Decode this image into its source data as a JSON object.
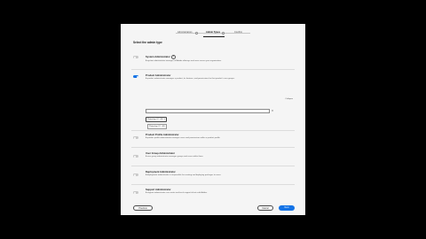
{
  "stepper": {
    "steps": [
      {
        "label": "Administrators"
      },
      {
        "label": "Admin Types"
      },
      {
        "label": "Confirm"
      }
    ],
    "active_index": 1
  },
  "section_title": "Select the admin type",
  "roles": [
    {
      "name": "System Administrator",
      "description": "A system administrator manages all Adobe offerings and users across your organization.",
      "enabled": false,
      "has_info": true
    },
    {
      "name": "Product Administrator",
      "description": "A product administrator manages a product, its features, and permissions for that product's user groups.",
      "enabled": true,
      "has_info": false
    },
    {
      "name": "Product Profile Administrator",
      "description": "A product profile administrator manages users and permissions within a product profile.",
      "enabled": false,
      "has_info": false
    },
    {
      "name": "User Group Administrator",
      "description": "A user group administrator manages groups and users within them.",
      "enabled": false,
      "has_info": false
    },
    {
      "name": "Deployment Administrator",
      "description": "A deployment administrator is responsible for creating and deploying packages to users.",
      "enabled": false,
      "has_info": false
    },
    {
      "name": "Support Administrator",
      "description": "A support administrator can create and track support tickets with Adobe.",
      "enabled": false,
      "has_info": false
    }
  ],
  "collapse_label": "Collapse",
  "product_select": {
    "placeholder": "",
    "chevron_icon": "chevron-down-icon"
  },
  "selected_tag": {
    "label": "Photoshop CC - EN"
  },
  "tooltip_text": "Photoshop CC - EN",
  "buttons": {
    "previous": "Previous",
    "cancel": "Cancel",
    "next": "Next"
  },
  "colors": {
    "accent": "#1473e6",
    "background": "#000000",
    "page": "#f5f5f5"
  }
}
